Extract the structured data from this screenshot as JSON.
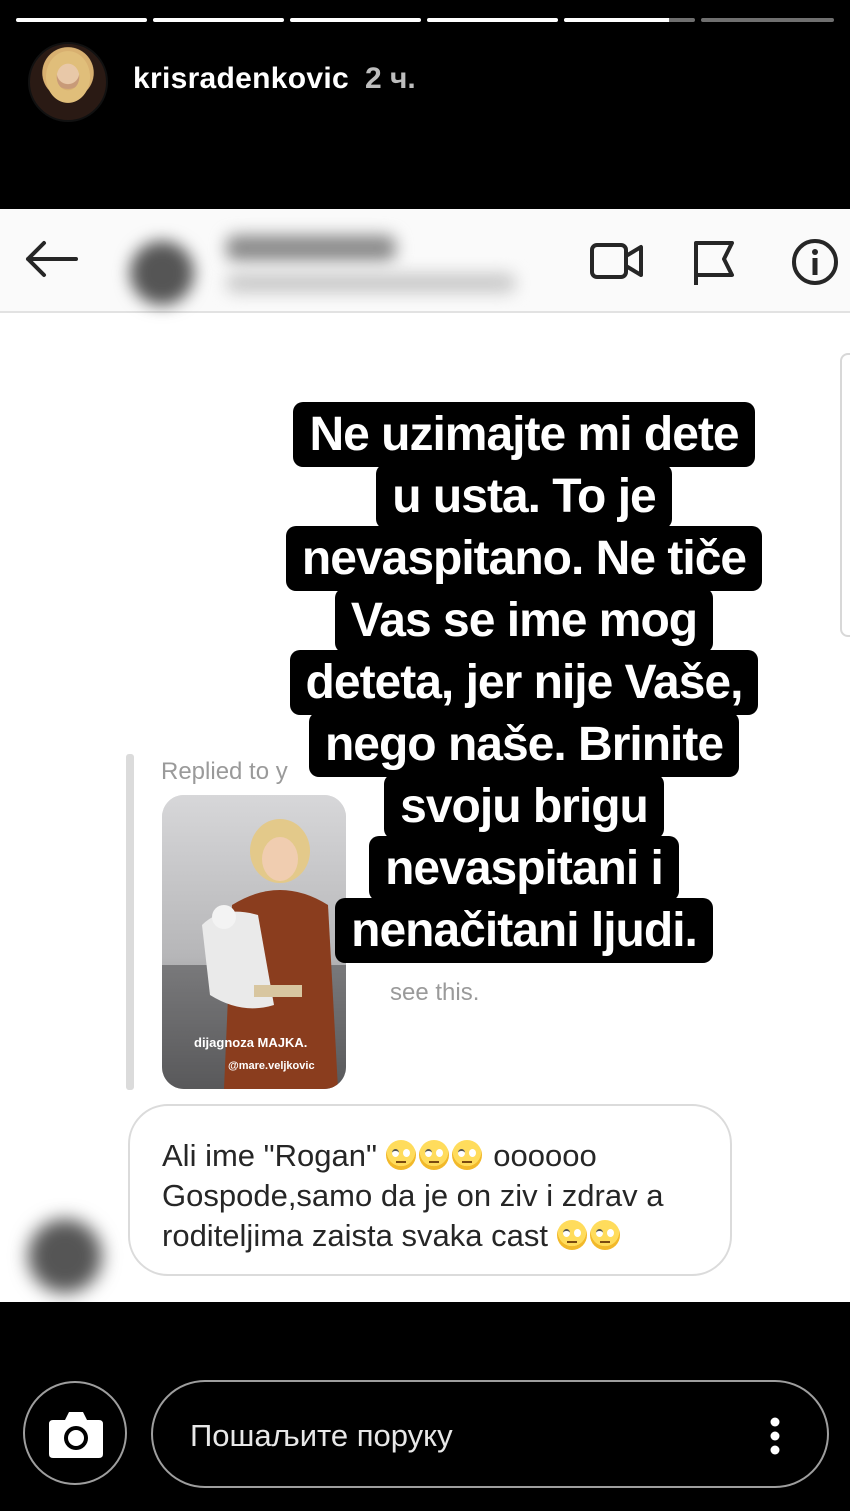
{
  "story": {
    "progress": [
      1,
      1,
      1,
      1,
      0.8,
      0
    ],
    "username": "krisradenkovic",
    "time": "2 ч."
  },
  "dm": {
    "header_icons": [
      "back-arrow-icon",
      "video-call-icon",
      "flag-icon",
      "info-icon"
    ],
    "replied_label": "Replied to y",
    "thumbnail": {
      "caption": "dijagnoza MAJKA.",
      "handle": "@mare.veljkovic"
    },
    "see_this": "see this.",
    "message": {
      "line1": "Ali ime \"Rogan\"",
      "line1_tail": " oooooo",
      "line2": "Gospode,samo da je on ziv i zdrav a",
      "line3": "roditeljima zaista svaka cast"
    }
  },
  "overlay_lines": [
    "Ne uzimajte mi dete",
    "u usta. To je",
    "nevaspitano. Ne tiče",
    "Vas se ime mog",
    "deteta, jer nije Vaše,",
    "nego naše. Brinite",
    "svoju brigu",
    "nevaspitani i",
    "nenačitani ljudi."
  ],
  "footer": {
    "placeholder": "Пошаљите поруку",
    "camera_icon": "camera-icon",
    "more_icon": "more-vertical-icon"
  }
}
